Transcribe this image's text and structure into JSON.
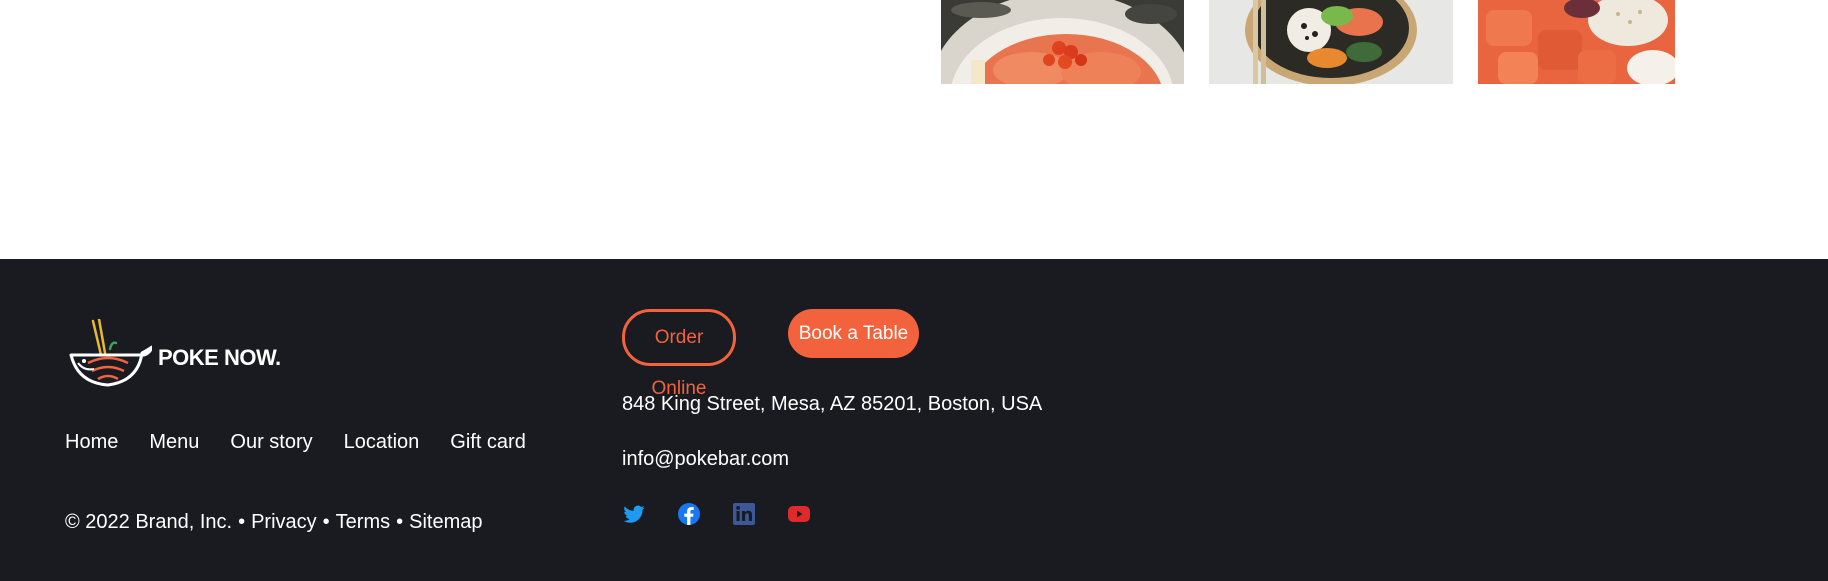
{
  "brand": {
    "name": "POKE NOW.",
    "accent_color": "#f2633d",
    "footer_bg": "#191b20"
  },
  "gallery": [
    {
      "icon": "salmon-roe-bowl-photo"
    },
    {
      "icon": "poke-bowl-chopsticks-photo"
    },
    {
      "icon": "salmon-poke-photo"
    }
  ],
  "footer": {
    "nav": [
      "Home",
      "Menu",
      "Our story",
      "Location",
      "Gift card"
    ],
    "legal": {
      "copyright": "© 2022 Brand, Inc.",
      "separator": "•",
      "privacy": "Privacy",
      "terms": "Terms",
      "sitemap": "Sitemap"
    },
    "order_online": "Order Online",
    "book_table": "Book a Table",
    "address": "848 King Street, Mesa, AZ 85201, Boston, USA",
    "email": "info@pokebar.com",
    "social": [
      {
        "icon": "twitter-icon",
        "color": "#1d9bf0"
      },
      {
        "icon": "facebook-icon",
        "color": "#1877f2"
      },
      {
        "icon": "linkedin-icon",
        "color": "#3b5998"
      },
      {
        "icon": "youtube-icon",
        "color": "#e02a2a"
      }
    ]
  }
}
